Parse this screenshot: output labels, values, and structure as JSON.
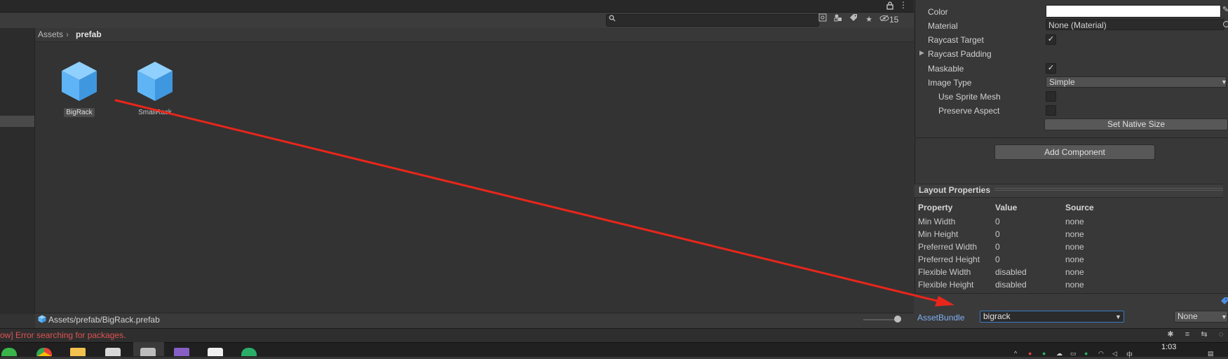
{
  "project": {
    "breadcrumb": [
      "Assets",
      "prefab"
    ],
    "breadcrumb_sep": "›",
    "hidden_count": "15",
    "assets": [
      {
        "name": "BigRack",
        "selected": true
      },
      {
        "name": "SmallRack",
        "selected": false
      }
    ],
    "selected_path": "Assets/prefab/BigRack.prefab",
    "icons": [
      "lock-icon",
      "more-icon",
      "search-icon",
      "scene-search-icon",
      "filter-type-icon",
      "label-icon",
      "favorite-icon",
      "visibility-icon"
    ]
  },
  "inspector": {
    "properties": [
      {
        "label": "Color",
        "type": "color",
        "value": "#ffffff"
      },
      {
        "label": "Material",
        "type": "object",
        "value": "None (Material)"
      },
      {
        "label": "Raycast Target",
        "type": "checkbox",
        "checked": true
      },
      {
        "label": "Raycast Padding",
        "type": "foldout"
      },
      {
        "label": "Maskable",
        "type": "checkbox",
        "checked": true
      },
      {
        "label": "Image Type",
        "type": "dropdown",
        "value": "Simple"
      },
      {
        "label": "Use Sprite Mesh",
        "type": "checkbox",
        "checked": false
      },
      {
        "label": "Preserve Aspect",
        "type": "checkbox",
        "checked": false
      }
    ],
    "set_native_size": "Set Native Size",
    "add_component": "Add Component",
    "layout_properties": {
      "title": "Layout Properties",
      "headers": [
        "Property",
        "Value",
        "Source"
      ],
      "rows": [
        [
          "Min Width",
          "0",
          "none"
        ],
        [
          "Min Height",
          "0",
          "none"
        ],
        [
          "Preferred Width",
          "0",
          "none"
        ],
        [
          "Preferred Height",
          "0",
          "none"
        ],
        [
          "Flexible Width",
          "disabled",
          "none"
        ],
        [
          "Flexible Height",
          "disabled",
          "none"
        ]
      ]
    },
    "asset_bundle": {
      "label": "AssetBundle",
      "name": "bigrack",
      "variant": "None"
    }
  },
  "console": {
    "message": "ow] Error searching for packages."
  },
  "taskbar": {
    "time": "1:03",
    "apps": [
      "360-icon",
      "chrome-icon",
      "folder-icon",
      "unity-hub-icon",
      "unity-icon",
      "visual-studio-icon",
      "typora-icon",
      "wechat-icon"
    ]
  },
  "colors": {
    "accent_blue": "#3a79c4",
    "error_red": "#e05252",
    "annotation_arrow": "#e8261b",
    "prefab_blue": "#5fb4f5"
  }
}
